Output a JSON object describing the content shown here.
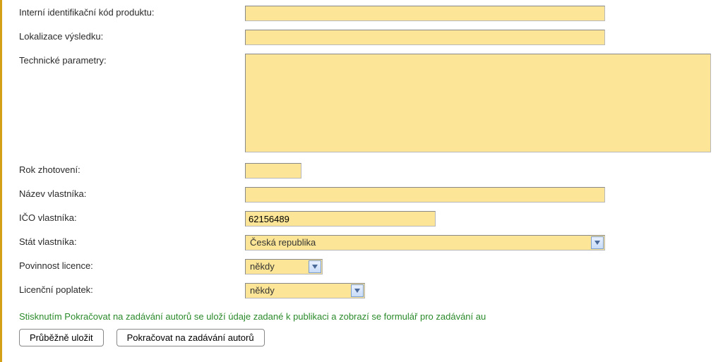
{
  "fields": {
    "internalCode": {
      "label": "Interní identifikační kód produktu:",
      "value": ""
    },
    "localization": {
      "label": "Lokalizace výsledku:",
      "value": ""
    },
    "techParams": {
      "label": "Technické parametry:",
      "value": ""
    },
    "year": {
      "label": "Rok zhotovení:",
      "value": ""
    },
    "ownerName": {
      "label": "Název vlastníka:",
      "value": ""
    },
    "ownerIco": {
      "label": "IČO vlastníka:",
      "value": "62156489"
    },
    "ownerState": {
      "label": "Stát vlastníka:",
      "value": "Česká republika"
    },
    "licenseDuty": {
      "label": "Povinnost licence:",
      "value": "někdy"
    },
    "licenseFee": {
      "label": "Licenční poplatek:",
      "value": "někdy"
    }
  },
  "infoText": "Stisknutím Pokračovat na zadávání autorů se uloží údaje zadané k publikaci a zobrazí se formulář pro zadávání au",
  "buttons": {
    "saveDraft": "Průběžně uložit",
    "continue": "Pokračovat na zadávání autorů"
  }
}
